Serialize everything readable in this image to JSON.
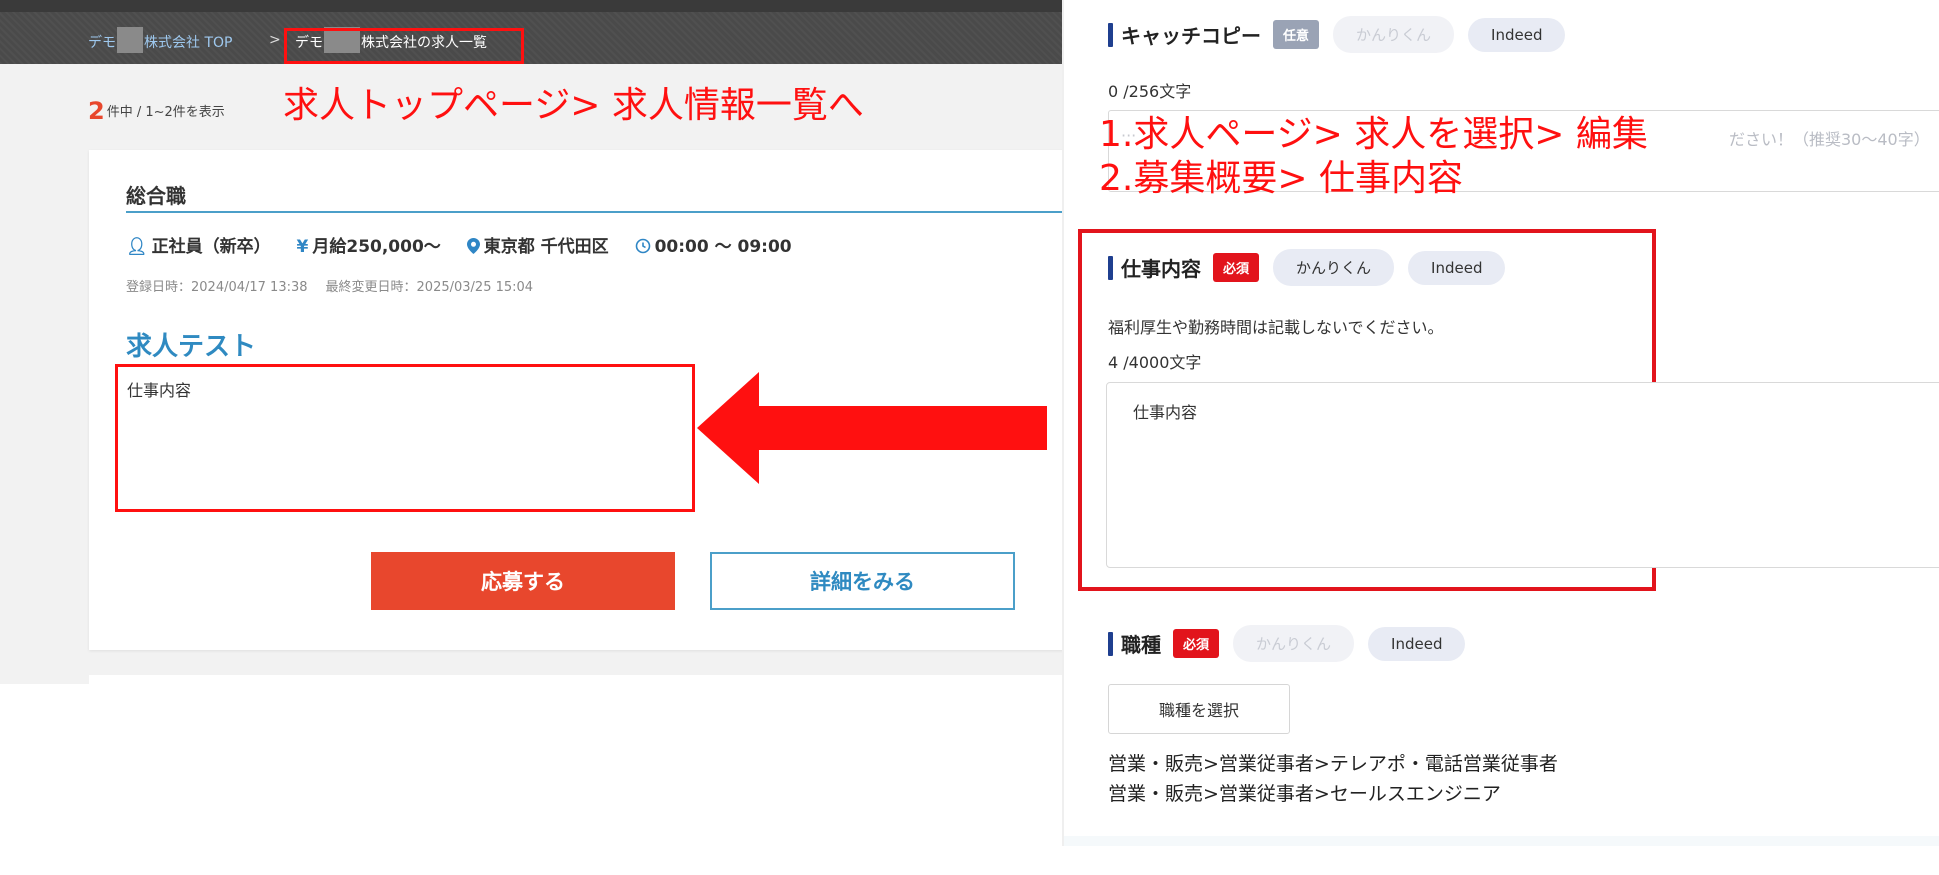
{
  "breadcrumb": {
    "top_prefix": "デモ",
    "top_suffix": "株式会社 TOP",
    "separator": ">",
    "current_prefix": "デモ",
    "current_suffix": "株式会社の求人一覧"
  },
  "result_count": {
    "number": "2",
    "text": "件中 / 1~2件を表示"
  },
  "annotations": {
    "left_note": "求人トップページ> 求人情報一覧へ",
    "right_note_1": "1.求人ページ> 求人を選択> 編集",
    "right_note_2": "2.募集概要> 仕事内容"
  },
  "job_card": {
    "category": "総合職",
    "employment_type": "正社員（新卒）",
    "salary": "月給250,000〜",
    "location": "東京都 千代田区",
    "hours": "00:00 ～ 09:00",
    "registered": "登録日時：2024/04/17 13:38",
    "modified": "最終変更日時：2025/03/25 15:04",
    "title": "求人テスト",
    "body": "仕事内容",
    "apply_label": "応募する",
    "detail_label": "詳細をみる"
  },
  "form": {
    "catchcopy": {
      "title": "キャッチコピー",
      "badge": "任意",
      "pill1": "かんりくん",
      "pill2": "Indeed",
      "counter": "0 /256文字",
      "placeholder_visible": "ださい！（推奨30〜40字）"
    },
    "job_content": {
      "title": "仕事内容",
      "badge": "必須",
      "pill1": "かんりくん",
      "pill2": "Indeed",
      "hint": "福利厚生や勤務時間は記載しないでください。",
      "counter": "4 /4000文字",
      "value": "仕事内容"
    },
    "job_type": {
      "title": "職種",
      "badge": "必須",
      "pill1": "かんりくん",
      "pill2": "Indeed",
      "select_label": "職種を選択",
      "values": [
        "営業・販売>営業従事者>テレアポ・電話営業従事者",
        "営業・販売>営業従事者>セールスエンジニア"
      ]
    }
  },
  "icons": {
    "person": "person-icon",
    "yen": "yen-icon",
    "pin": "map-pin-icon",
    "clock": "clock-icon",
    "arrow": "left-arrow"
  },
  "colors": {
    "annotation_red": "#ff1010",
    "accent_blue": "#2f8ac1",
    "apply_orange": "#e8472d",
    "required_red": "#e2141c",
    "section_bar_navy": "#1f3f8f"
  }
}
